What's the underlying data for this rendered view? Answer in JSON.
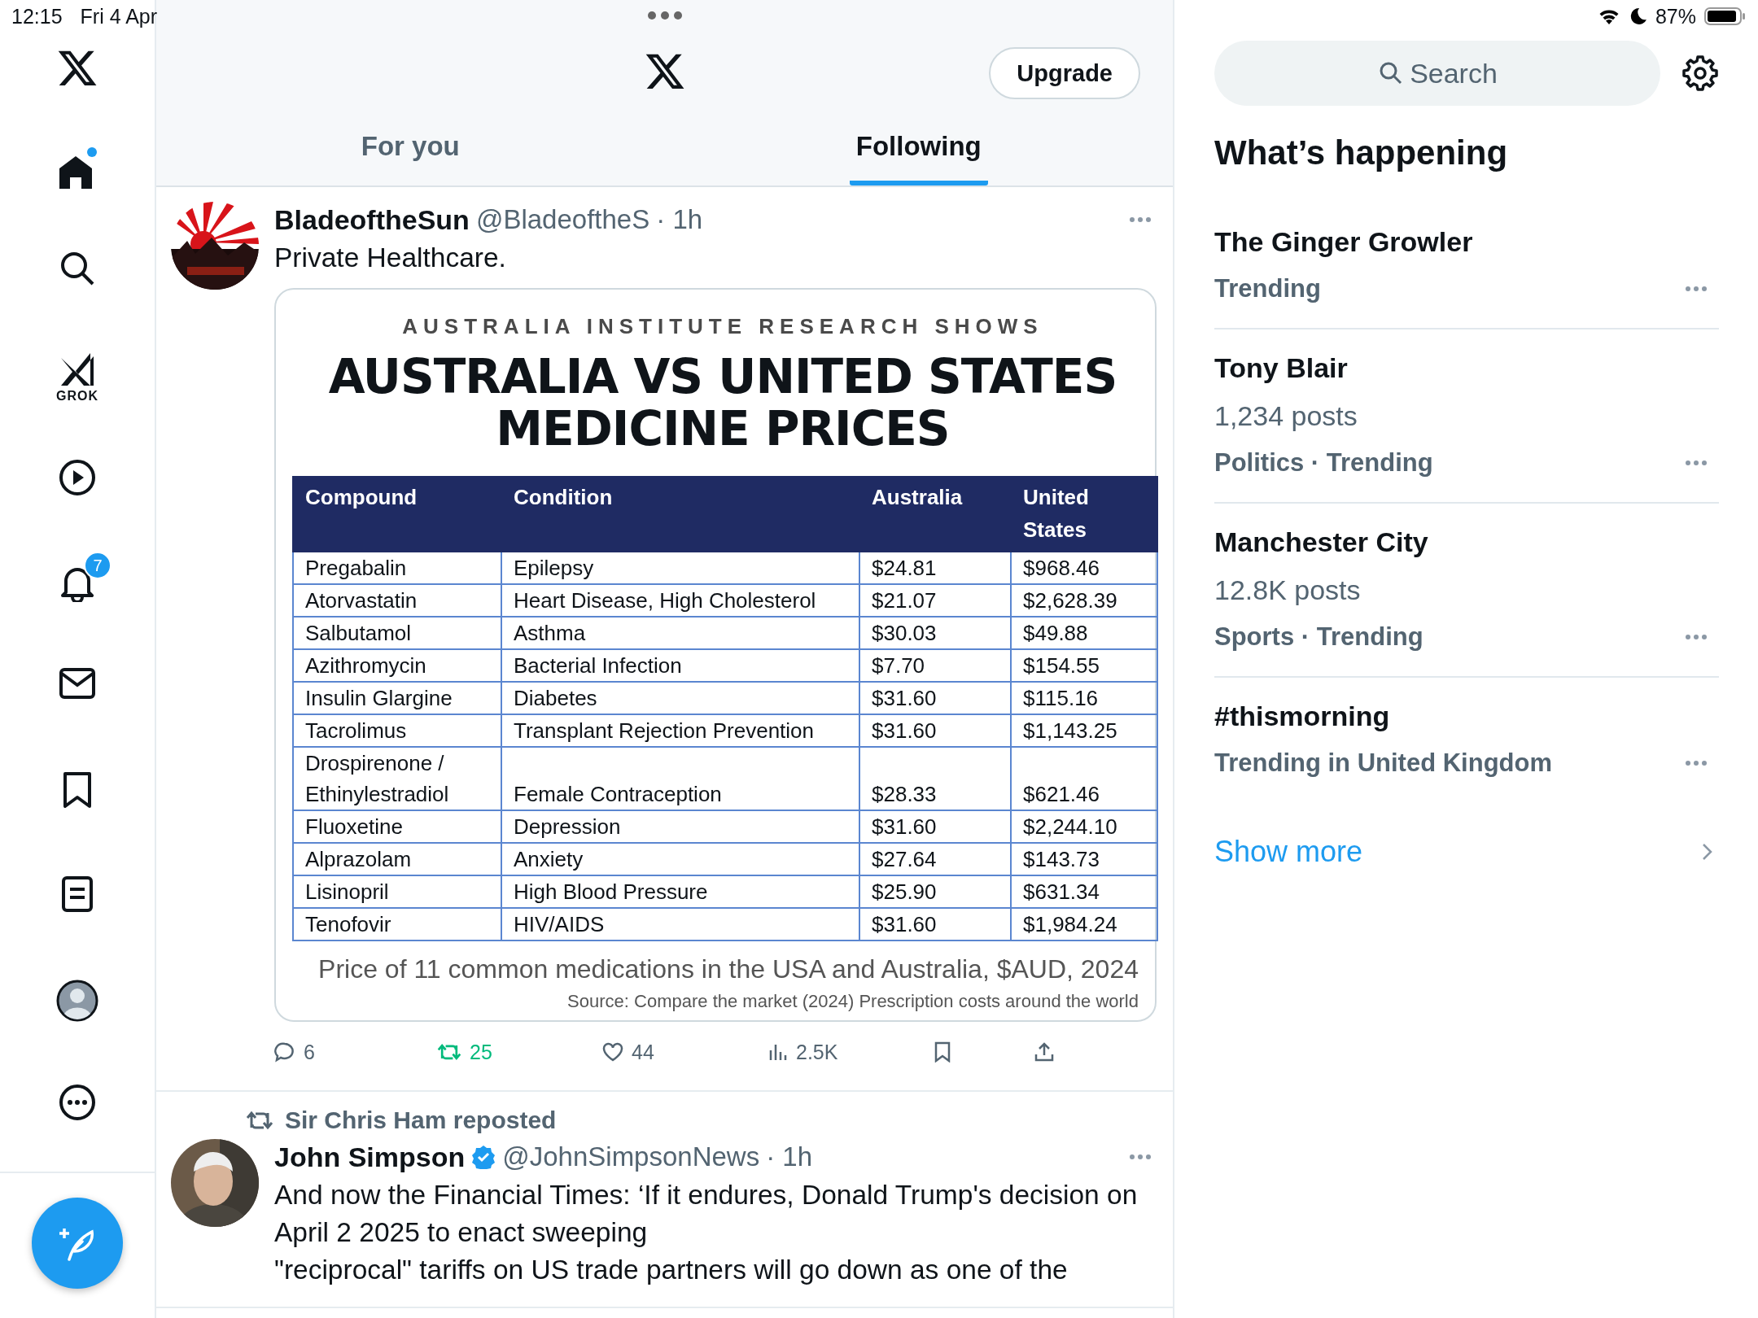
{
  "status_bar": {
    "time": "12:15",
    "date": "Fri 4 Apr",
    "battery": "87%"
  },
  "sidebar": {
    "items": [
      {
        "kind": "logo"
      },
      {
        "kind": "home",
        "dot": true
      },
      {
        "kind": "search"
      },
      {
        "kind": "grok",
        "label": "GROK"
      },
      {
        "kind": "video"
      },
      {
        "kind": "notifications",
        "badge": "7"
      },
      {
        "kind": "messages"
      },
      {
        "kind": "bookmarks"
      },
      {
        "kind": "lists"
      },
      {
        "kind": "profile"
      },
      {
        "kind": "more"
      }
    ]
  },
  "header": {
    "upgrade": "Upgrade"
  },
  "tabs": [
    {
      "label": "For you",
      "selected": false
    },
    {
      "label": "Following",
      "selected": true
    }
  ],
  "posts": [
    {
      "name": "BladeoftheSun",
      "handle": "@BladeoftheS",
      "time": "· 1h",
      "text": "Private Healthcare.",
      "image": {
        "kicker": "AUSTRALIA INSTITUTE RESEARCH SHOWS",
        "title_lines": [
          "AUSTRALIA VS UNITED STATES",
          "MEDICINE PRICES"
        ],
        "table": {
          "columns": [
            "Compound",
            "Condition",
            "Australia",
            "United States"
          ],
          "rows": [
            [
              "Pregabalin",
              "Epilepsy",
              "$24.81",
              "$968.46"
            ],
            [
              "Atorvastatin",
              "Heart Disease, High Cholesterol",
              "$21.07",
              "$2,628.39"
            ],
            [
              "Salbutamol",
              "Asthma",
              "$30.03",
              "$49.88"
            ],
            [
              "Azithromycin",
              "Bacterial Infection",
              "$7.70",
              "$154.55"
            ],
            [
              "Insulin Glargine",
              "Diabetes",
              "$31.60",
              "$115.16"
            ],
            [
              "Tacrolimus",
              "Transplant Rejection Prevention",
              "$31.60",
              "$1,143.25"
            ],
            [
              "Drospirenone / Ethinylestradiol",
              "Female Contraception",
              "$28.33",
              "$621.46"
            ],
            [
              "Fluoxetine",
              "Depression",
              "$31.60",
              "$2,244.10"
            ],
            [
              "Alprazolam",
              "Anxiety",
              "$27.64",
              "$143.73"
            ],
            [
              "Lisinopril",
              "High Blood Pressure",
              "$25.90",
              "$631.34"
            ],
            [
              "Tenofovir",
              "HIV/AIDS",
              "$31.60",
              "$1,984.24"
            ]
          ]
        },
        "caption": "Price of 11 common medications in the USA and Australia, $AUD, 2024",
        "source": "Source: Compare the market (2024) Prescription costs around the world"
      },
      "actions": [
        {
          "kind": "reply",
          "count": "6",
          "active": false
        },
        {
          "kind": "repost",
          "count": "25",
          "active": true
        },
        {
          "kind": "like",
          "count": "44",
          "active": false
        },
        {
          "kind": "views",
          "count": "2.5K",
          "active": false
        },
        {
          "kind": "bookmark",
          "active": false
        },
        {
          "kind": "share",
          "active": false
        }
      ]
    },
    {
      "reposted_by": "Sir Chris Ham reposted",
      "name": "John Simpson",
      "verified": true,
      "handle": "@JohnSimpsonNews",
      "time": "· 1h",
      "text": "And now the Financial Times: ‘If it endures, Donald Trump's decision on April 2 2025 to enact sweeping\n\"reciprocal\" tariffs on US trade partners will go down as one of the"
    }
  ],
  "search": {
    "placeholder": "Search"
  },
  "trends_panel": {
    "title": "What’s happening",
    "trends": [
      {
        "title": "The Ginger Growler",
        "category": "Trending"
      },
      {
        "title": "Tony Blair",
        "posts": "1,234 posts",
        "category": "Politics · Trending"
      },
      {
        "title": "Manchester City",
        "posts": "12.8K posts",
        "category": "Sports · Trending"
      },
      {
        "title": "#thismorning",
        "category": "Trending in United Kingdom"
      }
    ],
    "show_more": "Show more"
  }
}
